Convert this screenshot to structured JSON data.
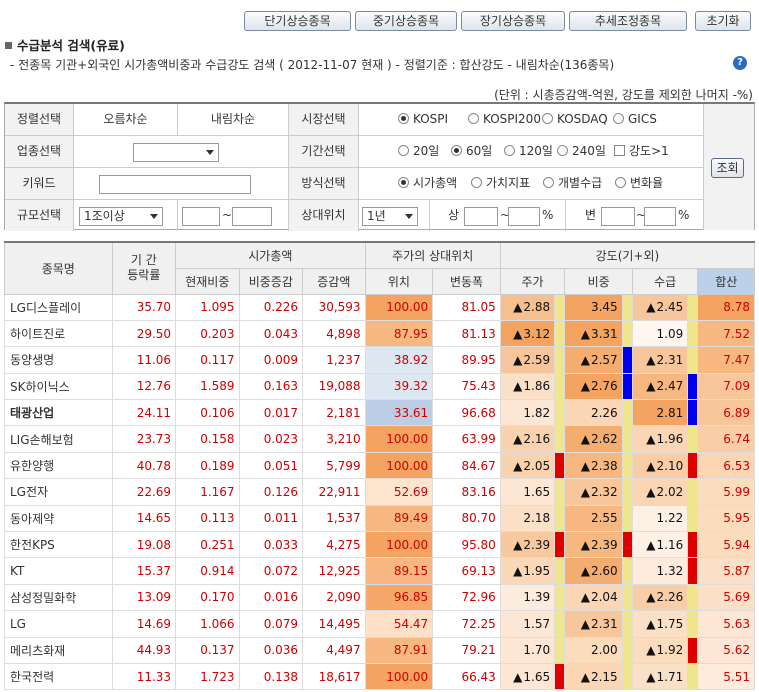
{
  "topButtons": [
    "단기상승종목",
    "중기상승종목",
    "장기상승종목",
    "추세조정종목",
    "초기화"
  ],
  "title": "수급분석 검색(유료)",
  "subinfo": "- 전종목 기관+외국인 시가총액비중과 수급강도 검색 ( 2012-11-07 현재 )  - 정렬기준 : 합산강도 - 내림차순(136종목)",
  "unit": "(단위 : 시총증감액-억원, 강도를 제외한 나머지 -%)",
  "form": {
    "sortLabel": "정렬선택",
    "asc": "오름차순",
    "desc": "내림차순",
    "marketLabel": "시장선택",
    "markets": [
      "KOSPI",
      "KOSPI200",
      "KOSDAQ",
      "GICS"
    ],
    "industryLabel": "업종선택",
    "periodLabel": "기간선택",
    "periods": [
      "20일",
      "60일",
      "120일",
      "240일"
    ],
    "strength": "강도>1",
    "keywordLabel": "키워드",
    "methodLabel": "방식선택",
    "methods": [
      "시가총액",
      "가치지표",
      "개별수급",
      "변화율"
    ],
    "sizeLabel": "규모선택",
    "sizeValue": "1조이상",
    "tilde": "~",
    "relLabel": "상대위치",
    "relValue": "1년",
    "upper": "상",
    "change": "변",
    "pct": "%",
    "lookup": "조회"
  },
  "table": {
    "headers": {
      "name": "종목명",
      "period": "기 간\n등락률",
      "mcap": "시가총액",
      "mcapCur": "현재비중",
      "mcapChg": "비중증감",
      "mcapAmt": "증감액",
      "rel": "주가의 상대위치",
      "relPos": "위치",
      "relVar": "변동폭",
      "str": "강도(기+외)",
      "strPrice": "주가",
      "strWeight": "비중",
      "strSupply": "수급",
      "strSum": "합산"
    },
    "rows": [
      {
        "name": "LG디스플레이",
        "period": "35.70",
        "cur": "1.095",
        "chg": "0.226",
        "amt": "30,593",
        "pos": "100.00",
        "var": "81.05",
        "price": "2.88",
        "pu": true,
        "weight": "3.45",
        "wu": false,
        "supply": "2.45",
        "su": true,
        "sum": "8.78"
      },
      {
        "name": "하이트진로",
        "period": "29.50",
        "cur": "0.203",
        "chg": "0.043",
        "amt": "4,898",
        "pos": "87.95",
        "var": "81.13",
        "price": "3.12",
        "pu": true,
        "weight": "3.31",
        "wu": true,
        "supply": "1.09",
        "su": false,
        "sum": "7.52"
      },
      {
        "name": "동양생명",
        "period": "11.06",
        "cur": "0.117",
        "chg": "0.009",
        "amt": "1,237",
        "pos": "38.92",
        "var": "89.95",
        "price": "2.59",
        "pu": true,
        "weight": "2.57",
        "wu": true,
        "supply": "2.31",
        "su": true,
        "sum": "7.47"
      },
      {
        "name": "SK하이닉스",
        "period": "12.76",
        "cur": "1.589",
        "chg": "0.163",
        "amt": "19,088",
        "pos": "39.32",
        "var": "75.43",
        "price": "1.86",
        "pu": true,
        "weight": "2.76",
        "wu": true,
        "supply": "2.47",
        "su": true,
        "sum": "7.09"
      },
      {
        "name": "태광산업",
        "period": "24.11",
        "cur": "0.106",
        "chg": "0.017",
        "amt": "2,181",
        "pos": "33.61",
        "var": "96.68",
        "price": "1.82",
        "pu": false,
        "weight": "2.26",
        "wu": false,
        "supply": "2.81",
        "su": false,
        "sum": "6.89"
      },
      {
        "name": "LIG손해보험",
        "period": "23.73",
        "cur": "0.158",
        "chg": "0.023",
        "amt": "3,210",
        "pos": "100.00",
        "var": "63.99",
        "price": "2.16",
        "pu": true,
        "weight": "2.62",
        "wu": true,
        "supply": "1.96",
        "su": true,
        "sum": "6.74"
      },
      {
        "name": "유한양행",
        "period": "40.78",
        "cur": "0.189",
        "chg": "0.051",
        "amt": "5,799",
        "pos": "100.00",
        "var": "84.67",
        "price": "2.05",
        "pu": true,
        "weight": "2.38",
        "wu": true,
        "supply": "2.10",
        "su": true,
        "sum": "6.53"
      },
      {
        "name": "LG전자",
        "period": "22.69",
        "cur": "1.167",
        "chg": "0.126",
        "amt": "22,911",
        "pos": "52.69",
        "var": "83.16",
        "price": "1.65",
        "pu": false,
        "weight": "2.32",
        "wu": true,
        "supply": "2.02",
        "su": true,
        "sum": "5.99"
      },
      {
        "name": "동아제약",
        "period": "14.65",
        "cur": "0.113",
        "chg": "0.011",
        "amt": "1,537",
        "pos": "89.49",
        "var": "80.70",
        "price": "2.18",
        "pu": false,
        "weight": "2.55",
        "wu": false,
        "supply": "1.22",
        "su": false,
        "sum": "5.95"
      },
      {
        "name": "한전KPS",
        "period": "19.08",
        "cur": "0.251",
        "chg": "0.033",
        "amt": "4,275",
        "pos": "100.00",
        "var": "95.80",
        "price": "2.39",
        "pu": true,
        "weight": "2.39",
        "wu": true,
        "supply": "1.16",
        "su": true,
        "sum": "5.94"
      },
      {
        "name": "KT",
        "period": "15.37",
        "cur": "0.914",
        "chg": "0.072",
        "amt": "12,925",
        "pos": "89.15",
        "var": "69.13",
        "price": "1.95",
        "pu": true,
        "weight": "2.60",
        "wu": true,
        "supply": "1.32",
        "su": false,
        "sum": "5.87"
      },
      {
        "name": "삼성정밀화학",
        "period": "13.09",
        "cur": "0.170",
        "chg": "0.016",
        "amt": "2,090",
        "pos": "96.85",
        "var": "72.96",
        "price": "1.39",
        "pu": false,
        "weight": "2.04",
        "wu": true,
        "supply": "2.26",
        "su": true,
        "sum": "5.69"
      },
      {
        "name": "LG",
        "period": "14.69",
        "cur": "1.066",
        "chg": "0.079",
        "amt": "14,495",
        "pos": "54.47",
        "var": "72.25",
        "price": "1.57",
        "pu": false,
        "weight": "2.31",
        "wu": true,
        "supply": "1.75",
        "su": true,
        "sum": "5.63"
      },
      {
        "name": "메리츠화재",
        "period": "44.93",
        "cur": "0.137",
        "chg": "0.036",
        "amt": "4,497",
        "pos": "87.91",
        "var": "79.21",
        "price": "1.70",
        "pu": false,
        "weight": "2.00",
        "wu": false,
        "supply": "1.92",
        "su": true,
        "sum": "5.62"
      },
      {
        "name": "한국전력",
        "period": "11.33",
        "cur": "1.723",
        "chg": "0.138",
        "amt": "18,617",
        "pos": "100.00",
        "var": "66.43",
        "price": "1.65",
        "pu": true,
        "weight": "2.15",
        "wu": true,
        "supply": "1.71",
        "su": true,
        "sum": "5.51"
      }
    ],
    "bold": [
      "태광산업"
    ],
    "bars": {
      "b1": [
        "#f0e68c",
        "#f0e68c",
        "#f0e68c",
        "#f0e68c",
        "#f0e68c",
        "#f0e68c",
        "#e00000",
        "#f0e68c",
        "#f0e68c",
        "#e00000",
        "#f0e68c",
        "#f0e68c",
        "#f0e68c",
        "#f0e68c",
        "#e00000"
      ],
      "b2": [
        "#f0e68c",
        "#f0e68c",
        "#0000ee",
        "#0000ee",
        "#f0e68c",
        "#f0e68c",
        "#f0e68c",
        "#f0e68c",
        "#f0e68c",
        "#e00000",
        "#f0e68c",
        "#f0e68c",
        "#f0e68c",
        "#f0e68c",
        "#f0e68c"
      ],
      "b3": [
        "#f0e68c",
        "#f0e68c",
        "#f0e68c",
        "#0000ee",
        "#0000ee",
        "#f0e68c",
        "#e00000",
        "#f0e68c",
        "#f0e68c",
        "#e00000",
        "#e00000",
        "#f0e68c",
        "#f0e68c",
        "#e00000",
        "#f0e68c"
      ]
    },
    "posColors": [
      "#f4a460",
      "#f6b880",
      "#dde7f2",
      "#dde7f2",
      "#bccde6",
      "#f4a460",
      "#f4a460",
      "#fde5cf",
      "#f6b880",
      "#f4a460",
      "#f6b880",
      "#f5a86a",
      "#fde0c5",
      "#f6b880",
      "#f4a460"
    ],
    "priceColors": [
      "#f6c08e",
      "#f4a460",
      "#f7c59b",
      "#fbe0c8",
      "#fde7d4",
      "#f9d3b0",
      "#f9d3b0",
      "#fde7d4",
      "#fce0c6",
      "#f8c89f",
      "#fad8b8",
      "#fdebdc",
      "#fde7d4",
      "#fde7d4",
      "#fde7d4"
    ],
    "weightColors": [
      "#f4a460",
      "#f4a460",
      "#f5ad6f",
      "#f4a460",
      "#fad6b4",
      "#f5ad6f",
      "#f6b880",
      "#f8c69b",
      "#f6b880",
      "#f6b880",
      "#f5ad6f",
      "#fad6b4",
      "#f8c69b",
      "#fbdcbd",
      "#fad6b4"
    ],
    "supplyColors": [
      "#f8c69b",
      "#fff7ef",
      "#f8c69b",
      "#f6b880",
      "#f4a460",
      "#fad6b4",
      "#f9cea7",
      "#fad6b4",
      "#fdf0e4",
      "#fdf0e4",
      "#fdebdc",
      "#f9cea7",
      "#fbe0c8",
      "#fbdcbd",
      "#fbe0c8"
    ],
    "sumColors": [
      "#f4a460",
      "#f6b880",
      "#f6b880",
      "#f8c69b",
      "#f8c69b",
      "#f9cea7",
      "#fad6b4",
      "#fbdcbd",
      "#fbdcbd",
      "#fbdcbd",
      "#fbe0c8",
      "#fbe0c8",
      "#fde7d4",
      "#fde7d4",
      "#fdebdc"
    ]
  }
}
